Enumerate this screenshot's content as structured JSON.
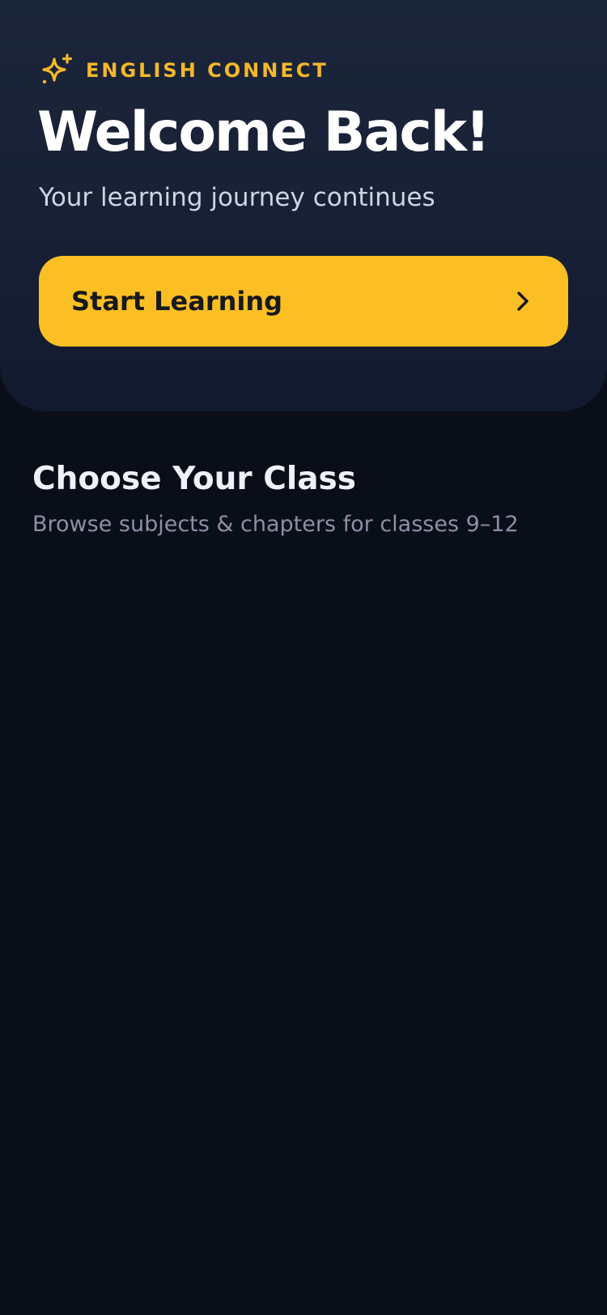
{
  "colors": {
    "accent": "#fbbf24",
    "brand_text": "#f5b82a",
    "hero_bg_top": "#1c263b",
    "hero_bg_bottom": "#111a2e",
    "page_bg": "#0a0e18",
    "title_text": "#ffffff",
    "subtitle_text": "#cdd5e2",
    "muted_text": "#8892a6"
  },
  "header": {
    "brand_icon": "sparkles-icon",
    "brand_label": "ENGLISH CONNECT",
    "title": "Welcome Back!",
    "subtitle": "Your learning journey continues"
  },
  "cta": {
    "label": "Start Learning",
    "icon": "chevron-right-icon"
  },
  "classes_section": {
    "title": "Choose Your Class",
    "subtitle": "Browse subjects & chapters for classes 9–12"
  }
}
